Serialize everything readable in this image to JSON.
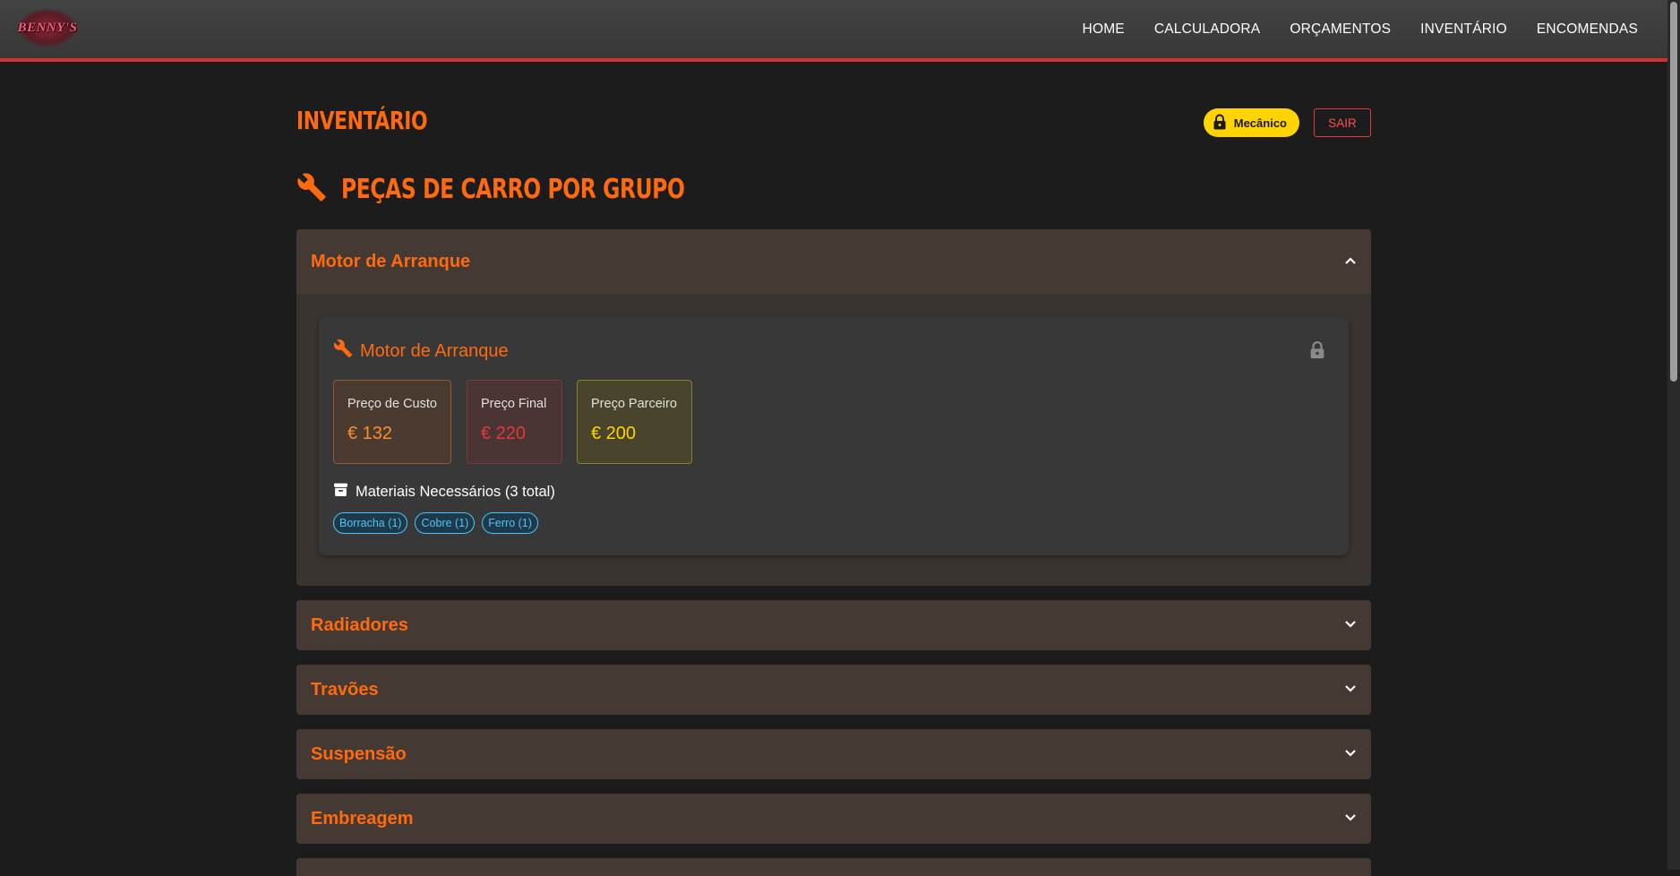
{
  "header": {
    "logo_text": "BENNY'S",
    "nav": [
      "HOME",
      "CALCULADORA",
      "ORÇAMENTOS",
      "INVENTÁRIO",
      "ENCOMENDAS"
    ]
  },
  "page": {
    "title": "INVENTÁRIO",
    "role_badge": "Mecânico",
    "logout_label": "SAIR",
    "section_title": "PEÇAS DE CARRO POR GRUPO"
  },
  "groups": {
    "open": {
      "label": "Motor de Arranque",
      "part": {
        "name": "Motor de Arranque",
        "prices": {
          "cost_label": "Preço de Custo",
          "cost_value": "€ 132",
          "final_label": "Preço Final",
          "final_value": "€ 220",
          "partner_label": "Preço Parceiro",
          "partner_value": "€ 200"
        },
        "materials_title": "Materiais Necessários (3 total)",
        "materials": [
          "Borracha (1)",
          "Cobre (1)",
          "Ferro (1)"
        ]
      }
    },
    "closed": [
      "Radiadores",
      "Travões",
      "Suspensão",
      "Embreagem"
    ]
  },
  "colors": {
    "accent_orange": "#ff6a10",
    "header_red_border": "#d32f2f",
    "badge_yellow": "#ffd400",
    "chip_blue": "#4fc3f7"
  },
  "icons": {
    "section": "wrench-icon",
    "badge": "lock-icon",
    "part": "wrench-icon",
    "part_lock": "lock-icon",
    "materials": "archive-box-icon",
    "open_chevron": "chevron-up-icon",
    "closed_chevron": "chevron-down-icon"
  }
}
